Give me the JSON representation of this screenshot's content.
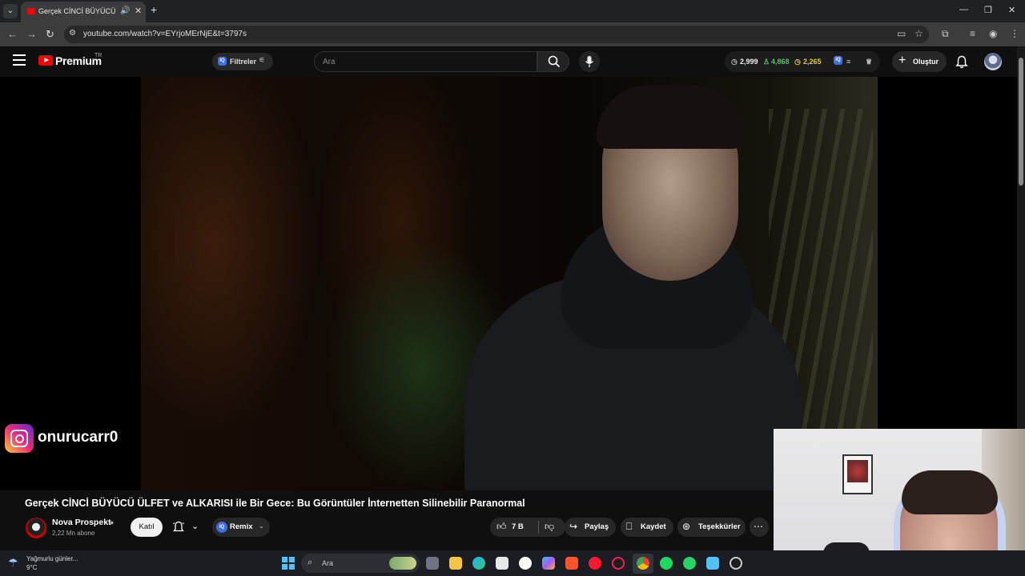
{
  "browser": {
    "tab_title": "Gerçek CİNCİ BÜYÜCÜ ÜLFET ve ALKARISI ile Bir Gece",
    "url": "youtube.com/watch?v=EYrjoMErNjE&t=3797s",
    "icons": [
      "tab-list-icon",
      "audio-icon",
      "close-icon",
      "new-tab-icon",
      "minimize-icon",
      "restore-icon",
      "window-close-icon",
      "back-icon",
      "forward-icon",
      "reload-icon",
      "site-info-icon",
      "cast-icon",
      "bookmark-star-icon",
      "extensions-icon",
      "reading-list-icon",
      "profile-icon",
      "kebab-menu-icon"
    ]
  },
  "masthead": {
    "logo_text": "Premium",
    "country": "TR",
    "filters_label": "Filtreler",
    "search_placeholder": "Ara",
    "stats": {
      "views": "2,999",
      "likes": "4,868",
      "time": "2,265"
    },
    "create_label": "Oluştur",
    "icons": [
      "menu-icon",
      "youtube-logo-icon",
      "search-icon",
      "mic-icon",
      "bell-icon"
    ]
  },
  "video": {
    "overlay_handle": "onurucarr0",
    "title": "Gerçek CİNCİ BÜYÜCÜ ÜLFET ve ALKARISI ile Bir Gece: Bu Görüntüler İnternetten Silinebilir Paranormal"
  },
  "channel": {
    "name": "Nova Prospekt",
    "subscribers": "2,22 Mn abone",
    "join_label": "Katıl"
  },
  "actions": {
    "remix_label": "Remix",
    "like_count": "7 B",
    "share_label": "Paylaş",
    "save_label": "Kaydet",
    "thanks_label": "Teşekkürler"
  },
  "taskbar": {
    "weather_text": "Yağmurlu günler...",
    "temperature": "9°C",
    "search_placeholder": "Ara",
    "apps": [
      "task-view",
      "file-explorer",
      "edge",
      "photos",
      "yandex",
      "copilot",
      "brave",
      "opera",
      "opera-gx",
      "chrome",
      "spotify",
      "whatsapp",
      "notepad",
      "steam"
    ]
  },
  "colors": {
    "youtube_red": "#ff0000",
    "background": "#0f0f0f",
    "accent_blue": "#3e6ee0"
  }
}
